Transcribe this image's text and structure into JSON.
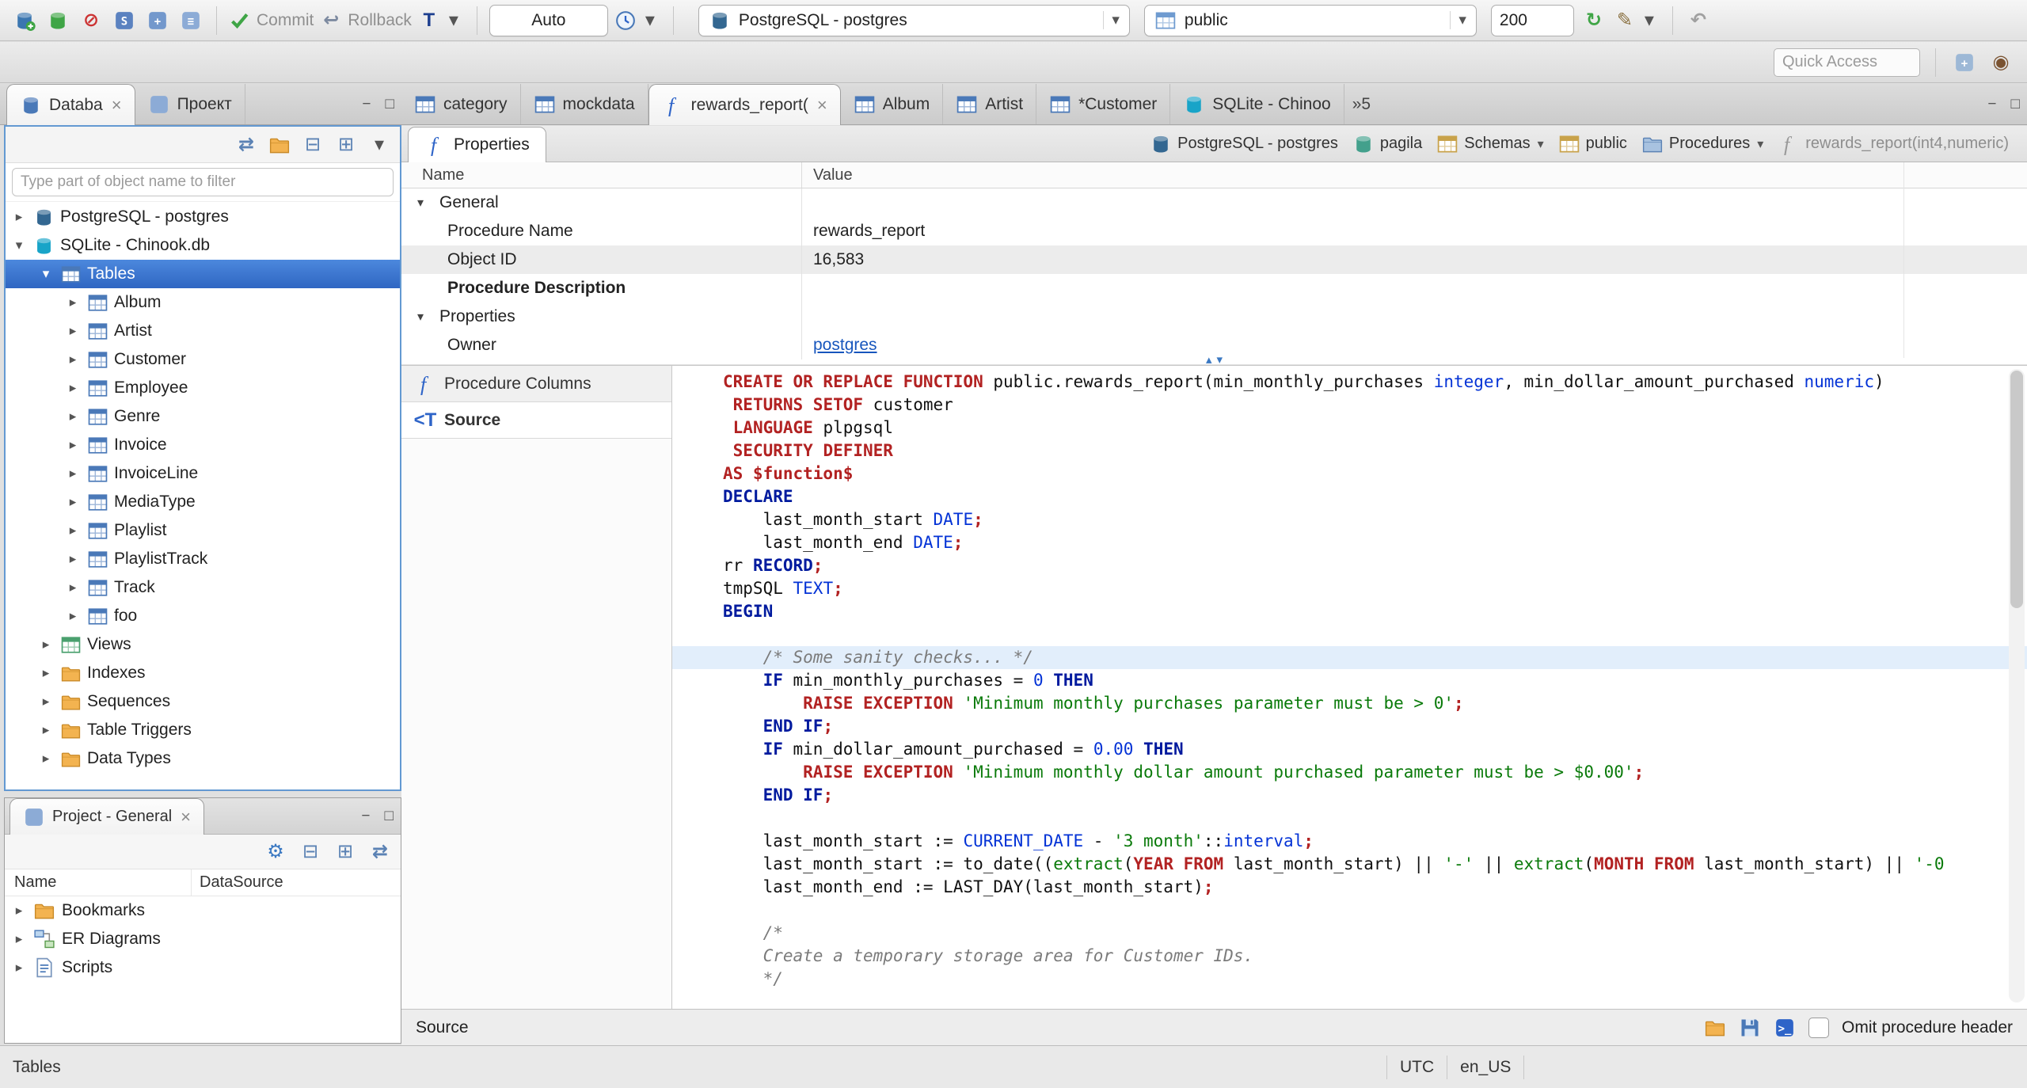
{
  "toolbar": {
    "commit": "Commit",
    "rollback": "Rollback",
    "auto": "Auto",
    "connection": "PostgreSQL - postgres",
    "schema": "public",
    "fetch_size": "200",
    "quick_access": "Quick Access"
  },
  "panels": {
    "navigator_tab": "Databa",
    "project_tab": "Проект",
    "filter_placeholder": "Type part of object name to filter",
    "project_title": "Project - General",
    "project_columns": [
      "Name",
      "DataSource"
    ],
    "project_items": [
      {
        "label": "Bookmarks",
        "icon": "folder-bookmarks"
      },
      {
        "label": "ER Diagrams",
        "icon": "er-diagram"
      },
      {
        "label": "Scripts",
        "icon": "script-doc"
      }
    ]
  },
  "tree": [
    {
      "label": "PostgreSQL - postgres",
      "icon": "postgres-db",
      "level": 0,
      "arrow": "right"
    },
    {
      "label": "SQLite - Chinook.db",
      "icon": "sqlite-db",
      "level": 0,
      "arrow": "down"
    },
    {
      "label": "Tables",
      "icon": "tables",
      "level": 1,
      "arrow": "down",
      "selected": true
    },
    {
      "label": "Album",
      "icon": "table",
      "level": 2,
      "arrow": "right"
    },
    {
      "label": "Artist",
      "icon": "table",
      "level": 2,
      "arrow": "right"
    },
    {
      "label": "Customer",
      "icon": "table",
      "level": 2,
      "arrow": "right"
    },
    {
      "label": "Employee",
      "icon": "table",
      "level": 2,
      "arrow": "right"
    },
    {
      "label": "Genre",
      "icon": "table",
      "level": 2,
      "arrow": "right"
    },
    {
      "label": "Invoice",
      "icon": "table",
      "level": 2,
      "arrow": "right"
    },
    {
      "label": "InvoiceLine",
      "icon": "table",
      "level": 2,
      "arrow": "right"
    },
    {
      "label": "MediaType",
      "icon": "table",
      "level": 2,
      "arrow": "right"
    },
    {
      "label": "Playlist",
      "icon": "table",
      "level": 2,
      "arrow": "right"
    },
    {
      "label": "PlaylistTrack",
      "icon": "table",
      "level": 2,
      "arrow": "right"
    },
    {
      "label": "Track",
      "icon": "table",
      "level": 2,
      "arrow": "right"
    },
    {
      "label": "foo",
      "icon": "table",
      "level": 2,
      "arrow": "right"
    },
    {
      "label": "Views",
      "icon": "views",
      "level": 1,
      "arrow": "right"
    },
    {
      "label": "Indexes",
      "icon": "folder",
      "level": 1,
      "arrow": "right"
    },
    {
      "label": "Sequences",
      "icon": "folder",
      "level": 1,
      "arrow": "right"
    },
    {
      "label": "Table Triggers",
      "icon": "folder",
      "level": 1,
      "arrow": "right"
    },
    {
      "label": "Data Types",
      "icon": "folder",
      "level": 1,
      "arrow": "right"
    }
  ],
  "editor_tabs": [
    {
      "label": "category",
      "icon": "table"
    },
    {
      "label": "mockdata",
      "icon": "table"
    },
    {
      "label": "rewards_report(",
      "icon": "function",
      "active": true
    },
    {
      "label": "Album",
      "icon": "table"
    },
    {
      "label": "Artist",
      "icon": "table"
    },
    {
      "label": "*Customer",
      "icon": "table"
    },
    {
      "label": "SQLite - Chinoo",
      "icon": "sqlite-db"
    }
  ],
  "tabs_overflow": "»5",
  "breadcrumb": [
    {
      "label": "PostgreSQL - postgres",
      "icon": "postgres-db"
    },
    {
      "label": "pagila",
      "icon": "pagila-db"
    },
    {
      "label": "Schemas",
      "icon": "schemas",
      "dropdown": true
    },
    {
      "label": "public",
      "icon": "schema-public"
    },
    {
      "label": "Procedures",
      "icon": "procedures",
      "dropdown": true
    },
    {
      "label": "rewards_report(int4,numeric)",
      "icon": "fn-gray",
      "muted": true
    }
  ],
  "properties": {
    "tab": "Properties",
    "columns": [
      "Name",
      "Value"
    ],
    "rows": [
      {
        "kind": "group",
        "name": "General"
      },
      {
        "kind": "prop",
        "name": "Procedure Name",
        "value": "rewards_report"
      },
      {
        "kind": "prop",
        "name": "Object ID",
        "value": "16,583",
        "shaded": true
      },
      {
        "kind": "prop",
        "name": "Procedure Description",
        "value": "",
        "bold": true
      },
      {
        "kind": "group",
        "name": "Properties"
      },
      {
        "kind": "prop",
        "name": "Owner",
        "value": "postgres",
        "link": true
      }
    ]
  },
  "subtabs": [
    {
      "label": "Procedure Columns",
      "icon": "function"
    },
    {
      "label": "Source",
      "icon": "source-tab",
      "active": true
    }
  ],
  "source": {
    "highlight_line": 12,
    "lines": [
      [
        [
          "k",
          "CREATE OR REPLACE FUNCTION"
        ],
        [
          "p",
          " public.rewards_report(min_monthly_purchases "
        ],
        [
          "t",
          "integer"
        ],
        [
          "p",
          ", min_dollar_amount_purchased "
        ],
        [
          "t",
          "numeric"
        ],
        [
          "p",
          ")"
        ]
      ],
      [
        [
          "p",
          " "
        ],
        [
          "k",
          "RETURNS SETOF"
        ],
        [
          "p",
          " customer"
        ]
      ],
      [
        [
          "p",
          " "
        ],
        [
          "k",
          "LANGUAGE"
        ],
        [
          "p",
          " plpgsql"
        ]
      ],
      [
        [
          "p",
          " "
        ],
        [
          "k",
          "SECURITY DEFINER"
        ]
      ],
      [
        [
          "k",
          "AS $function$"
        ]
      ],
      [
        [
          "n",
          "DECLARE"
        ]
      ],
      [
        [
          "p",
          "    last_month_start "
        ],
        [
          "t",
          "DATE"
        ],
        [
          "k",
          ";"
        ]
      ],
      [
        [
          "p",
          "    last_month_end "
        ],
        [
          "t",
          "DATE"
        ],
        [
          "k",
          ";"
        ]
      ],
      [
        [
          "p",
          "rr "
        ],
        [
          "n",
          "RECORD"
        ],
        [
          "k",
          ";"
        ]
      ],
      [
        [
          "p",
          "tmpSQL "
        ],
        [
          "t",
          "TEXT"
        ],
        [
          "k",
          ";"
        ]
      ],
      [
        [
          "n",
          "BEGIN"
        ]
      ],
      [],
      [
        [
          "c",
          "    /* Some sanity checks... */"
        ]
      ],
      [
        [
          "p",
          "    "
        ],
        [
          "n",
          "IF"
        ],
        [
          "p",
          " min_monthly_purchases = "
        ],
        [
          "t",
          "0"
        ],
        [
          "p",
          " "
        ],
        [
          "n",
          "THEN"
        ]
      ],
      [
        [
          "p",
          "        "
        ],
        [
          "k",
          "RAISE EXCEPTION"
        ],
        [
          "p",
          " "
        ],
        [
          "s",
          "'Minimum monthly purchases parameter must be > 0'"
        ],
        [
          "k",
          ";"
        ]
      ],
      [
        [
          "p",
          "    "
        ],
        [
          "n",
          "END IF"
        ],
        [
          "k",
          ";"
        ]
      ],
      [
        [
          "p",
          "    "
        ],
        [
          "n",
          "IF"
        ],
        [
          "p",
          " min_dollar_amount_purchased = "
        ],
        [
          "t",
          "0.00"
        ],
        [
          "p",
          " "
        ],
        [
          "n",
          "THEN"
        ]
      ],
      [
        [
          "p",
          "        "
        ],
        [
          "k",
          "RAISE EXCEPTION"
        ],
        [
          "p",
          " "
        ],
        [
          "s",
          "'Minimum monthly dollar amount purchased parameter must be > $0.00'"
        ],
        [
          "k",
          ";"
        ]
      ],
      [
        [
          "p",
          "    "
        ],
        [
          "n",
          "END IF"
        ],
        [
          "k",
          ";"
        ]
      ],
      [],
      [
        [
          "p",
          "    last_month_start := "
        ],
        [
          "t",
          "CURRENT_DATE"
        ],
        [
          "p",
          " - "
        ],
        [
          "s",
          "'3 month'"
        ],
        [
          "p",
          "::"
        ],
        [
          "t",
          "interval"
        ],
        [
          "k",
          ";"
        ]
      ],
      [
        [
          "p",
          "    last_month_start := to_date(("
        ],
        [
          "s",
          "extract"
        ],
        [
          "p",
          "("
        ],
        [
          "k",
          "YEAR FROM"
        ],
        [
          "p",
          " last_month_start) || "
        ],
        [
          "s",
          "'-'"
        ],
        [
          "p",
          " || "
        ],
        [
          "s",
          "extract"
        ],
        [
          "p",
          "("
        ],
        [
          "k",
          "MONTH FROM"
        ],
        [
          "p",
          " last_month_start) || "
        ],
        [
          "s",
          "'-0"
        ]
      ],
      [
        [
          "p",
          "    last_month_end := LAST_DAY(last_month_start)"
        ],
        [
          "k",
          ";"
        ]
      ],
      [],
      [
        [
          "c",
          "    /*"
        ]
      ],
      [
        [
          "c",
          "    Create a temporary storage area for Customer IDs."
        ]
      ],
      [
        [
          "c",
          "    */"
        ]
      ]
    ]
  },
  "editor_footer": {
    "label": "Source",
    "omit": "Omit procedure header"
  },
  "status": {
    "left": "Tables",
    "tz": "UTC",
    "locale": "en_US"
  },
  "icons": {
    "new-connection": {
      "k": "db",
      "c": "#3b76b0",
      "plus": true
    },
    "connect-db": {
      "k": "db",
      "c": "#3fa546"
    },
    "disconnect": {
      "k": "glyph",
      "t": "⊘",
      "c": "#cc3333",
      "b": true
    },
    "sql-editor": {
      "k": "box",
      "c": "#5b82c0",
      "t": "S"
    },
    "sql-new": {
      "k": "box",
      "c": "#7398cc",
      "t": "+"
    },
    "sql-recent": {
      "k": "box",
      "c": "#8cabd6",
      "t": "≡"
    },
    "commit-check": {
      "k": "check"
    },
    "rollback-arrow": {
      "k": "glyph",
      "t": "↩",
      "c": "#7d8aa0",
      "b": true
    },
    "txn-mode": {
      "k": "glyph",
      "t": "T",
      "c": "#1d3f8f",
      "b": true
    },
    "clock": {
      "k": "clock"
    },
    "caret-down": {
      "k": "glyph",
      "t": "▾",
      "c": "#555555"
    },
    "menu-caret": {
      "k": "glyph",
      "t": "▾",
      "c": "#555555"
    },
    "postgres-db": {
      "k": "db",
      "c": "#336791"
    },
    "sqlite-db": {
      "k": "db",
      "c": "#18a4c8"
    },
    "pagila-db": {
      "k": "db",
      "c": "#43a08c"
    },
    "schema-blue": {
      "k": "table",
      "c": "#6f9bd0"
    },
    "refresh": {
      "k": "glyph",
      "t": "↻",
      "c": "#3fa546",
      "b": true
    },
    "wand": {
      "k": "glyph",
      "t": "✎",
      "c": "#8a7040"
    },
    "back-arrow": {
      "k": "glyph",
      "t": "↶",
      "c": "#a0a0a0",
      "b": true
    },
    "window-plus": {
      "k": "box",
      "c": "#9db8d6",
      "t": "+"
    },
    "dbeaver-logo": {
      "k": "glyph",
      "t": "◉",
      "c": "#7a5230"
    },
    "nav-db": {
      "k": "db",
      "c": "#4a79b8"
    },
    "project-view": {
      "k": "box",
      "c": "#8cabd6",
      "t": ""
    },
    "tables": {
      "k": "table",
      "c": "#4a79b8"
    },
    "table": {
      "k": "table",
      "c": "#4a79b8"
    },
    "views": {
      "k": "table",
      "c": "#4aa06e"
    },
    "folder": {
      "k": "folder",
      "c": "#f3b350"
    },
    "function": {
      "k": "fn",
      "c": "#2e64c8"
    },
    "fn-gray": {
      "k": "fn",
      "c": "#9a9a9a"
    },
    "source-tab": {
      "k": "glyph",
      "t": "<T",
      "c": "#2e64c8",
      "b": true
    },
    "schemas": {
      "k": "table",
      "c": "#c8a24a"
    },
    "schema-public": {
      "k": "table",
      "c": "#c8a24a"
    },
    "procedures": {
      "k": "folder",
      "c": "#a8c2e0",
      "s": "#5b82b4"
    },
    "folder-bookmarks": {
      "k": "folder",
      "c": "#f3b350"
    },
    "er-diagram": {
      "k": "er"
    },
    "script-doc": {
      "k": "doc"
    },
    "gear": {
      "k": "glyph",
      "t": "⚙",
      "c": "#3a78c2",
      "b": true
    },
    "collapse-all": {
      "k": "glyph",
      "t": "⊟",
      "c": "#5b82b4"
    },
    "expand-all": {
      "k": "glyph",
      "t": "⊞",
      "c": "#5b82b4"
    },
    "link-editor": {
      "k": "glyph",
      "t": "⇄",
      "c": "#5b82b4",
      "b": true
    },
    "folder-new": {
      "k": "folder",
      "c": "#f3b350"
    },
    "open-folder": {
      "k": "folder",
      "c": "#f3b350"
    },
    "save": {
      "k": "save"
    },
    "console": {
      "k": "box",
      "c": "#2e64c8",
      "t": ">_"
    }
  }
}
